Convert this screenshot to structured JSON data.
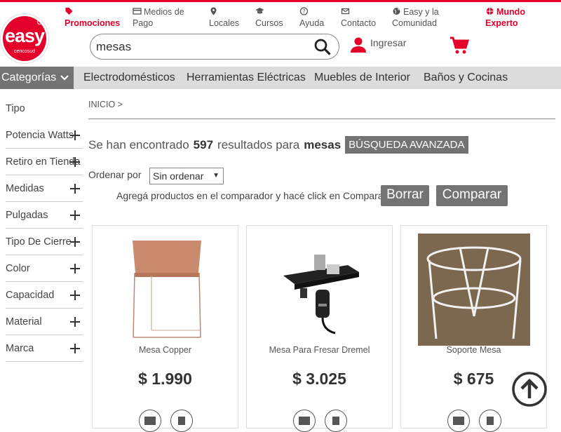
{
  "header": {
    "logo_brand": "easy",
    "logo_sub": "cencosud",
    "links": {
      "promociones": "Promociones",
      "medios_pago": "Medios de Pago",
      "locales": "Locales",
      "cursos": "Cursos",
      "ayuda": "Ayuda",
      "contacto": "Contacto",
      "comunidad": "Easy y la Comunidad",
      "mundo_experto": "Mundo Experto"
    },
    "search_value": "mesas",
    "login_label": "Ingresar"
  },
  "nav": {
    "categories_label": "Categorías",
    "items": [
      "Electrodomésticos",
      "Herramientas Eléctricas",
      "Muebles de Interior",
      "Baños y Cocinas"
    ]
  },
  "sidebar": {
    "facets": [
      "Tipo",
      "Potencia Watts",
      "Retiro en Tienda",
      "Medidas",
      "Pulgadas",
      "Tipo De Cierre",
      "Color",
      "Capacidad",
      "Material",
      "Marca"
    ]
  },
  "breadcrumb": "INICIO  >",
  "results": {
    "prefix": "Se han encontrado",
    "count": "597",
    "middle": "resultados para",
    "query": "mesas",
    "advanced_button": "BÚSQUEDA AVANZADA"
  },
  "sort": {
    "label": "Ordenar por",
    "selected": "Sin ordenar"
  },
  "compare": {
    "hint": "Agregá productos en el comparador y hacé click en Comparar",
    "clear_button": "Borrar",
    "compare_button": "Comparar"
  },
  "products": [
    {
      "name": "Mesa Copper",
      "price": "$ 1.990"
    },
    {
      "name": "Mesa Para Fresar Dremel",
      "price": "$ 3.025"
    },
    {
      "name": "Soporte Mesa",
      "price": "$ 675"
    }
  ],
  "colors": {
    "brand_red": "#e4002b",
    "dark_gray_button": "#737373",
    "nav_bg": "#dcdcdc"
  }
}
